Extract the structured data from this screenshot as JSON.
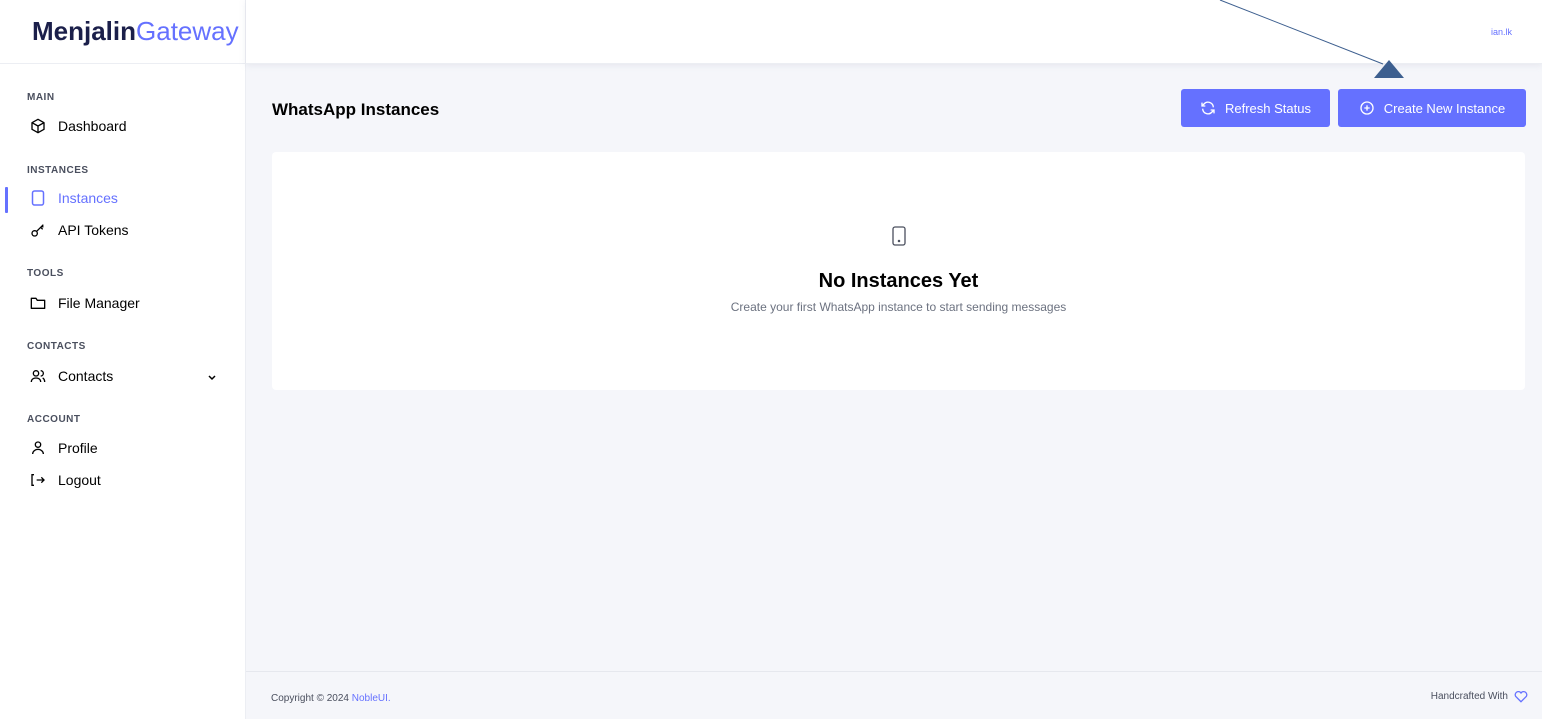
{
  "brand": {
    "part1": "Menjalin",
    "part2": "Gateway"
  },
  "user": {
    "name": "ian.lk"
  },
  "sidebar": {
    "sections": [
      {
        "label": "MAIN"
      },
      {
        "label": "INSTANCES"
      },
      {
        "label": "TOOLS"
      },
      {
        "label": "CONTACTS"
      },
      {
        "label": "ACCOUNT"
      }
    ],
    "items": [
      {
        "label": "Dashboard",
        "icon": "box-icon"
      },
      {
        "label": "Instances",
        "icon": "tablet-icon",
        "active": true
      },
      {
        "label": "API Tokens",
        "icon": "key-icon"
      },
      {
        "label": "File Manager",
        "icon": "folder-icon"
      },
      {
        "label": "Contacts",
        "icon": "users-icon",
        "has_submenu": true
      },
      {
        "label": "Profile",
        "icon": "user-icon"
      },
      {
        "label": "Logout",
        "icon": "logout-icon"
      }
    ]
  },
  "page": {
    "title": "WhatsApp Instances",
    "refresh_label": "Refresh Status",
    "create_label": "Create New Instance"
  },
  "empty_state": {
    "title": "No Instances Yet",
    "subtitle": "Create your first WhatsApp instance to start sending messages"
  },
  "footer": {
    "copyright": "Copyright © 2024 ",
    "link": "NobleUI.",
    "right": "Handcrafted With"
  },
  "colors": {
    "accent": "#6571ff",
    "brand_dark": "#1b1f4a",
    "annotation": "#3d5f8f"
  }
}
